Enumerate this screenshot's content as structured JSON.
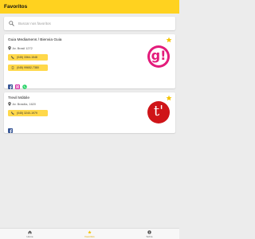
{
  "header": {
    "title": "Favoritos"
  },
  "search": {
    "placeholder": "Buscar nos favoritos",
    "value": ""
  },
  "colors": {
    "accent": "#ffd21f",
    "phone_button": "#ffd84a",
    "star": "#f5c400"
  },
  "favorites": [
    {
      "name": "Guia Mediamens / Bienvia Guia",
      "address": "Av. Brasil 1272",
      "phones": [
        "(045) 3364-1548",
        "(045) 99652-7380"
      ],
      "social": [
        "facebook-icon",
        "instagram-icon",
        "whatsapp-icon"
      ],
      "logo_glyph": "g!",
      "logo_color": "#e31b7b"
    },
    {
      "name": "Trevil Móbile",
      "address": "Av. Brasília, 1620",
      "phones": [
        "(045) 3240-1979"
      ],
      "social": [
        "facebook-icon"
      ],
      "logo_glyph": "t'",
      "logo_color": "#cf1418"
    }
  ],
  "nav": [
    {
      "label": "Home",
      "icon": "home-icon"
    },
    {
      "label": "Favoritos",
      "icon": "star-icon",
      "active": true
    },
    {
      "label": "Sobre",
      "icon": "info-icon"
    }
  ]
}
